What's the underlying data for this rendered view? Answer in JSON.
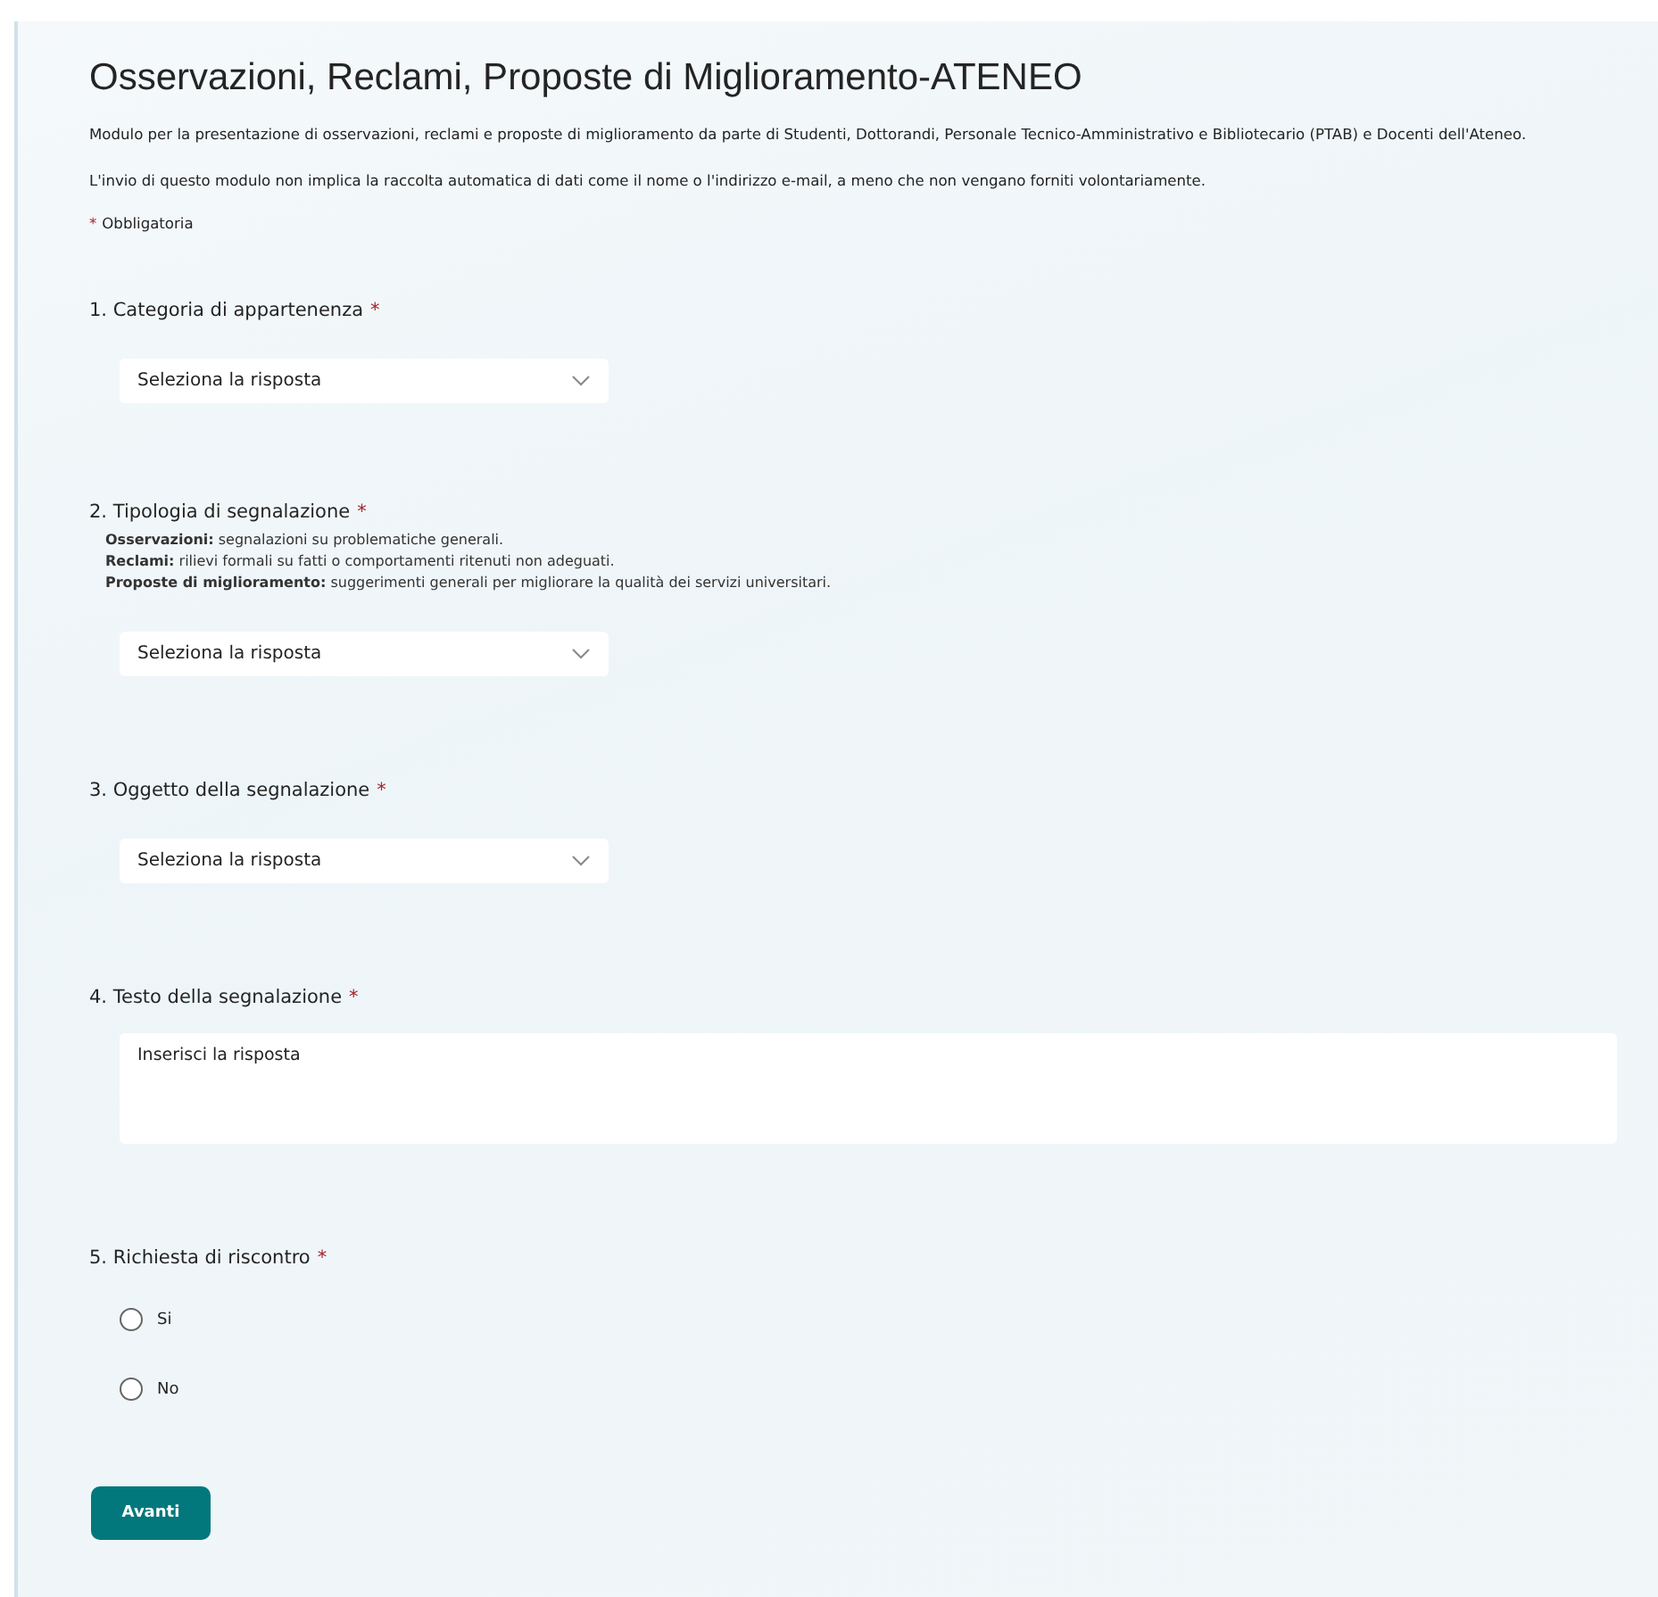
{
  "form": {
    "title": "Osservazioni, Reclami, Proposte di Miglioramento-ATENEO",
    "description": "Modulo per la presentazione di osservazioni, reclami e proposte di miglioramento da parte di Studenti, Dottorandi, Personale Tecnico-Amministrativo e Bibliotecario (PTAB) e Docenti dell'Ateneo.",
    "privacy_note": "L'invio di questo modulo non implica la raccolta automatica di dati come il nome o l'indirizzo e-mail, a meno che non vengano forniti volontariamente.",
    "required_legend": {
      "mark": "*",
      "text": "Obbligatoria"
    }
  },
  "questions": [
    {
      "kind": "select",
      "label": "1. Categoria di appartenenza",
      "mark": "*",
      "placeholder": "Seleziona la risposta"
    },
    {
      "kind": "select",
      "label": "2. Tipologia di segnalazione",
      "mark": "*",
      "help": [
        "**Osservazioni:** segnalazioni su problematiche generali.",
        "**Reclami:** rilievi formali su fatti o comportamenti ritenuti non adeguati.",
        "**Proposte di miglioramento:** suggerimenti generali per migliorare la qualità dei servizi universitari."
      ],
      "placeholder": "Seleziona la risposta"
    },
    {
      "kind": "select",
      "label": "3. Oggetto della segnalazione",
      "mark": "*",
      "placeholder": "Seleziona la risposta"
    },
    {
      "kind": "text",
      "label": "4. Testo della segnalazione",
      "mark": "*",
      "placeholder": "Inserisci la risposta"
    },
    {
      "kind": "radio",
      "label": "5. Richiesta di riscontro",
      "mark": "*",
      "options": [
        {
          "label": "Si",
          "selected": false
        },
        {
          "label": "No",
          "selected": false
        }
      ]
    }
  ],
  "next_button": "Avanti"
}
